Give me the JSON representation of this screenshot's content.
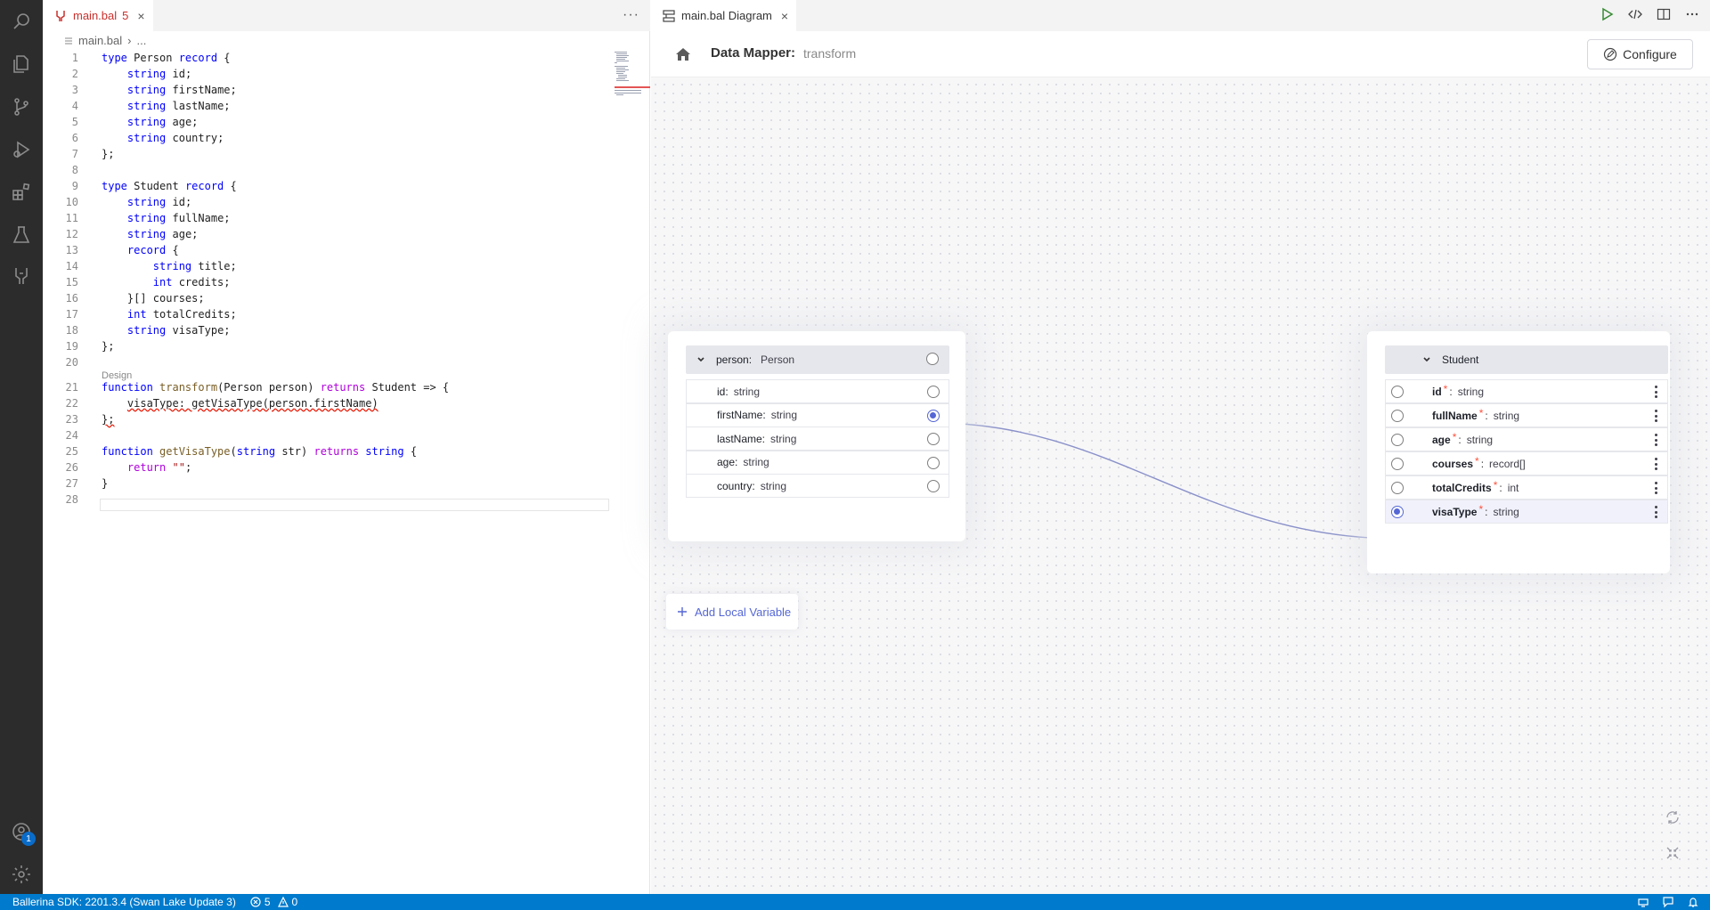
{
  "editor": {
    "tab": {
      "filename": "main.bal",
      "problems": "5",
      "close": "×"
    },
    "tab_more": "···",
    "breadcrumb": {
      "file": "main.bal",
      "sep": "›",
      "rest": "..."
    },
    "design_lens": "Design",
    "lines": [
      {
        "n": "1",
        "html": "<span class='kw'>type</span> Person <span class='kw'>record</span> {"
      },
      {
        "n": "2",
        "html": "    <span class='kw'>string</span> id;"
      },
      {
        "n": "3",
        "html": "    <span class='kw'>string</span> firstName;"
      },
      {
        "n": "4",
        "html": "    <span class='kw'>string</span> lastName;"
      },
      {
        "n": "5",
        "html": "    <span class='kw'>string</span> age;"
      },
      {
        "n": "6",
        "html": "    <span class='kw'>string</span> country;"
      },
      {
        "n": "7",
        "html": "};"
      },
      {
        "n": "8",
        "html": ""
      },
      {
        "n": "9",
        "html": "<span class='kw'>type</span> Student <span class='kw'>record</span> {"
      },
      {
        "n": "10",
        "html": "    <span class='kw'>string</span> id;"
      },
      {
        "n": "11",
        "html": "    <span class='kw'>string</span> fullName;"
      },
      {
        "n": "12",
        "html": "    <span class='kw'>string</span> age;"
      },
      {
        "n": "13",
        "html": "    <span class='kw'>record</span> {"
      },
      {
        "n": "14",
        "html": "        <span class='kw'>string</span> title;"
      },
      {
        "n": "15",
        "html": "        <span class='kw'>int</span> credits;"
      },
      {
        "n": "16",
        "html": "    }[] courses;"
      },
      {
        "n": "17",
        "html": "    <span class='kw'>int</span> totalCredits;"
      },
      {
        "n": "18",
        "html": "    <span class='kw'>string</span> visaType;"
      },
      {
        "n": "19",
        "html": "};"
      },
      {
        "n": "20",
        "html": ""
      },
      {
        "n": "21",
        "html": "<span class='kw'>function</span> <span class='fn'>transform</span>(Person person) <span class='kw2'>returns</span> Student => {"
      },
      {
        "n": "22",
        "html": "    <span class='err'>visaType: getVisaType(person.firstName)</span>"
      },
      {
        "n": "23",
        "html": "<span class='err'>};</span>"
      },
      {
        "n": "24",
        "html": ""
      },
      {
        "n": "25",
        "html": "<span class='kw'>function</span> <span class='fn'>getVisaType</span>(<span class='kw'>string</span> str) <span class='kw2'>returns</span> <span class='kw'>string</span> {"
      },
      {
        "n": "26",
        "html": "    <span class='kw2'>return</span> <span class='str'>\"\"</span>;"
      },
      {
        "n": "27",
        "html": "}"
      },
      {
        "n": "28",
        "html": ""
      }
    ]
  },
  "diagram": {
    "tab_title": "main.bal Diagram",
    "close": "×",
    "header_title": "Data Mapper:",
    "header_sub": "transform",
    "configure_label": "Configure",
    "source": {
      "head_name": "person:",
      "head_type": "Person",
      "fields": [
        {
          "name": "id:",
          "type": "string",
          "connected": false
        },
        {
          "name": "firstName:",
          "type": "string",
          "connected": true
        },
        {
          "name": "lastName:",
          "type": "string",
          "connected": false
        },
        {
          "name": "age:",
          "type": "string",
          "connected": false
        },
        {
          "name": "country:",
          "type": "string",
          "connected": false
        }
      ]
    },
    "target": {
      "head_name": "Student",
      "fields": [
        {
          "name": "id",
          "type": "string",
          "connected": false
        },
        {
          "name": "fullName",
          "type": "string",
          "connected": false
        },
        {
          "name": "age",
          "type": "string",
          "connected": false
        },
        {
          "name": "courses",
          "type": "record[]",
          "connected": false
        },
        {
          "name": "totalCredits",
          "type": "int",
          "connected": false
        },
        {
          "name": "visaType",
          "type": "string",
          "connected": true
        }
      ],
      "required_mark": "*",
      "colon": ":"
    },
    "add_variable": "Add Local Variable"
  },
  "statusbar": {
    "sdk": "Ballerina SDK: 2201.3.4 (Swan Lake Update 3)",
    "errors": "5",
    "warnings": "0"
  },
  "accounts_badge": "1",
  "colors": {
    "accent": "#5567d5",
    "statusbar": "#007acc",
    "activity": "#2c2c2c"
  }
}
